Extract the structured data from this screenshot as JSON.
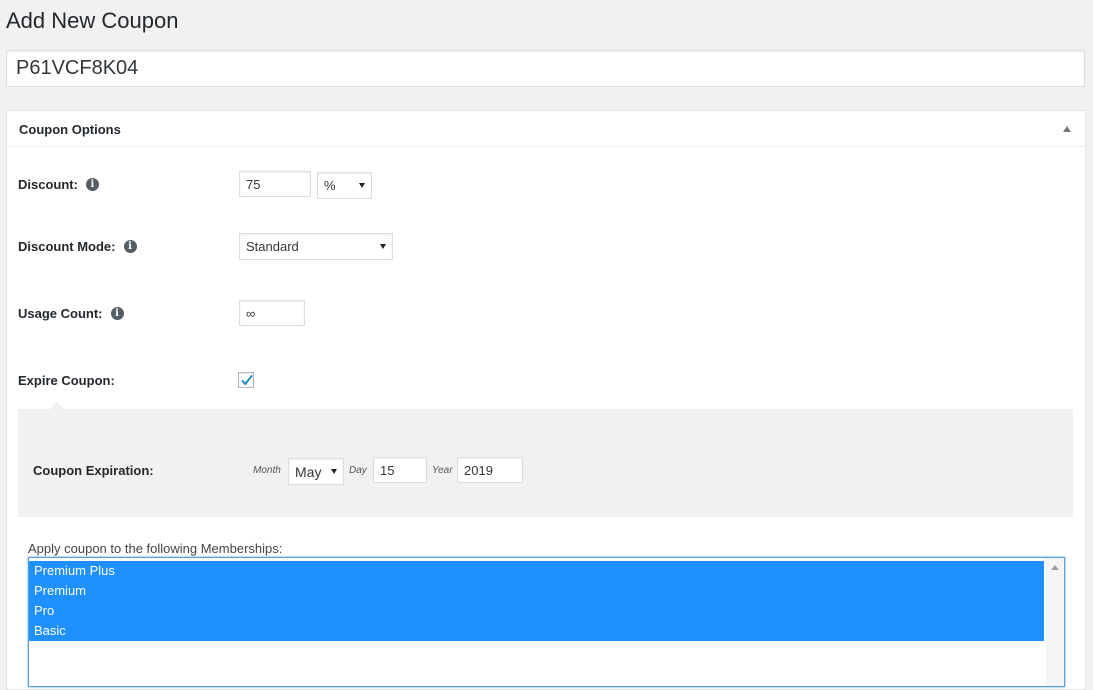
{
  "page": {
    "title": "Add New Coupon",
    "coupon_code": "P61VCF8K04"
  },
  "coupon_options": {
    "title": "Coupon Options",
    "discount": {
      "label": "Discount:",
      "value": "75",
      "type": "%"
    },
    "discount_mode": {
      "label": "Discount Mode:",
      "value": "Standard"
    },
    "usage_count": {
      "label": "Usage Count:",
      "value": "∞"
    },
    "expire_coupon": {
      "label": "Expire Coupon:",
      "checked": true
    },
    "expiration": {
      "label": "Coupon Expiration:",
      "month_label": "Month",
      "month": "May",
      "day_label": "Day",
      "day": "15",
      "year_label": "Year",
      "year": "2019"
    },
    "memberships": {
      "label": "Apply coupon to the following Memberships:",
      "options": [
        "Premium Plus",
        "Premium",
        "Pro",
        "Basic"
      ]
    }
  },
  "icons": {
    "info": "info-icon",
    "check": "check-icon",
    "collapse": "triangle-up-icon"
  },
  "colors": {
    "selected_option": "#1e90ff",
    "focus_border": "#5b9dd9"
  }
}
